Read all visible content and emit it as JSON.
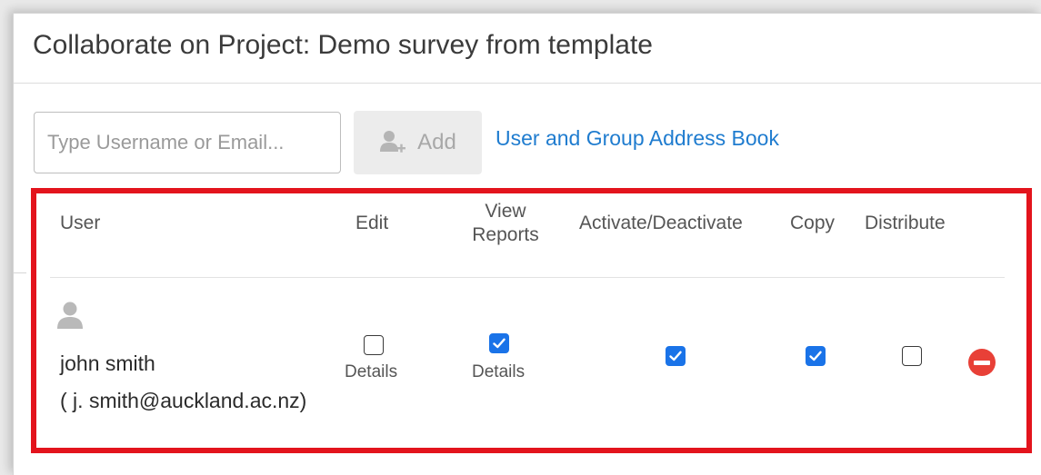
{
  "dialog": {
    "title": "Collaborate on Project: Demo survey from template"
  },
  "toolbar": {
    "user_input": {
      "value": "",
      "placeholder": "Type Username or Email..."
    },
    "add_label": "Add",
    "add_icon": "add-user-icon",
    "address_book_label": "User and Group Address Book"
  },
  "table": {
    "headers": {
      "user": "User",
      "edit": "Edit",
      "view_reports_line1": "View",
      "view_reports_line2": "Reports",
      "activate": "Activate/Deactivate",
      "copy": "Copy",
      "distribute": "Distribute"
    },
    "rows": [
      {
        "avatar_icon": "user-avatar-icon",
        "name": "john smith",
        "email": "( j. smith@auckland.ac.nz)",
        "edit": false,
        "edit_details": "Details",
        "view_reports": true,
        "view_reports_details": "Details",
        "activate": true,
        "copy": true,
        "distribute": false,
        "remove_icon": "remove-icon"
      }
    ]
  },
  "colors": {
    "accent": "#1a73e8",
    "link": "#1f7ccf",
    "highlight": "#e3141d",
    "remove": "#e84037"
  }
}
